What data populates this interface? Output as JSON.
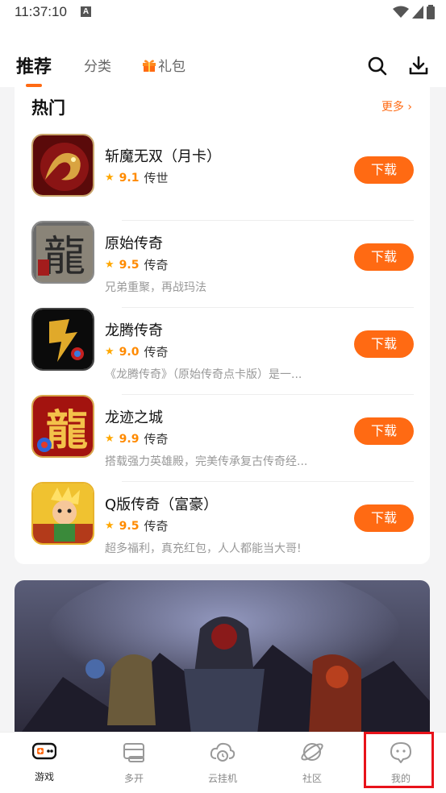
{
  "status_bar": {
    "time": "11:37:10",
    "notification_badge": "A"
  },
  "header": {
    "tabs": [
      {
        "label": "推荐",
        "active": true
      },
      {
        "label": "分类",
        "active": false
      },
      {
        "label": "礼包",
        "active": false
      }
    ],
    "icons": [
      "search-icon",
      "download-icon"
    ]
  },
  "hot_section": {
    "title": "热门",
    "more_label": "更多 ›",
    "games": [
      {
        "name": "斩魔无双（月卡）",
        "score": "9.1",
        "category": "传世",
        "description": "",
        "button": "下载"
      },
      {
        "name": "原始传奇",
        "score": "9.5",
        "category": "传奇",
        "description": "兄弟重聚，再战玛法",
        "button": "下载"
      },
      {
        "name": "龙腾传奇",
        "score": "9.0",
        "category": "传奇",
        "description": "《龙腾传奇》（原始传奇点卡版）是一...",
        "button": "下载"
      },
      {
        "name": "龙迹之城",
        "score": "9.9",
        "category": "传奇",
        "description": "搭载强力英雄殿，完美传承复古传奇经...",
        "button": "下载"
      },
      {
        "name": "Q版传奇（富豪）",
        "score": "9.5",
        "category": "传奇",
        "description": "超多福利，真充红包，人人都能当大哥!",
        "button": "下载"
      }
    ],
    "icon_glyphs": [
      "",
      "龍",
      "",
      "龍",
      ""
    ]
  },
  "bottom_nav": {
    "items": [
      {
        "label": "游戏",
        "icon": "gamepad-icon",
        "active": true
      },
      {
        "label": "多开",
        "icon": "multi-window-icon",
        "active": false
      },
      {
        "label": "云挂机",
        "icon": "cloud-clock-icon",
        "active": false
      },
      {
        "label": "社区",
        "icon": "planet-icon",
        "active": false
      },
      {
        "label": "我的",
        "icon": "profile-face-icon",
        "active": false
      }
    ]
  },
  "colors": {
    "accent": "#ff6a13",
    "star": "#ffa700",
    "highlight_border": "#e8121a"
  }
}
